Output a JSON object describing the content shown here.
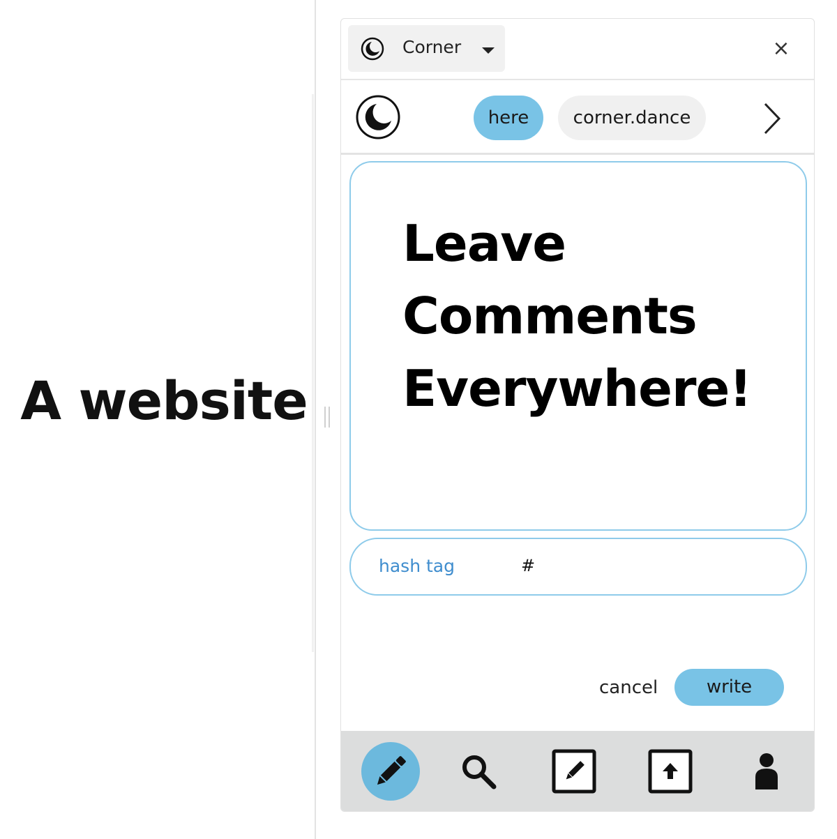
{
  "page": {
    "left_text": "A website"
  },
  "panel": {
    "selector": {
      "icon": "moon-icon",
      "label": "Corner",
      "caret_icon": "caret-down-icon"
    },
    "close_icon": "close-icon",
    "close_symbol": "×",
    "nav": {
      "logo_icon": "moon-icon",
      "pills": [
        "here",
        "corner.dance"
      ],
      "active_pill": "here",
      "next_icon": "chevron-right-icon"
    },
    "comment": {
      "line1": "Leave",
      "line2": "Comments",
      "line3": "Everywhere!"
    },
    "hashtag": {
      "label": "hash tag",
      "symbol": "#"
    },
    "actions": {
      "cancel_label": "cancel",
      "write_label": "write"
    },
    "bottom_nav": [
      "pencil-icon",
      "search-icon",
      "edit-square-icon",
      "upload-square-icon",
      "user-icon"
    ]
  },
  "colors": {
    "accent": "#79c3e6",
    "border_accent": "#8ecbea",
    "hashtag_label": "#3f8dce",
    "bottom_bar": "#dcdddd"
  }
}
